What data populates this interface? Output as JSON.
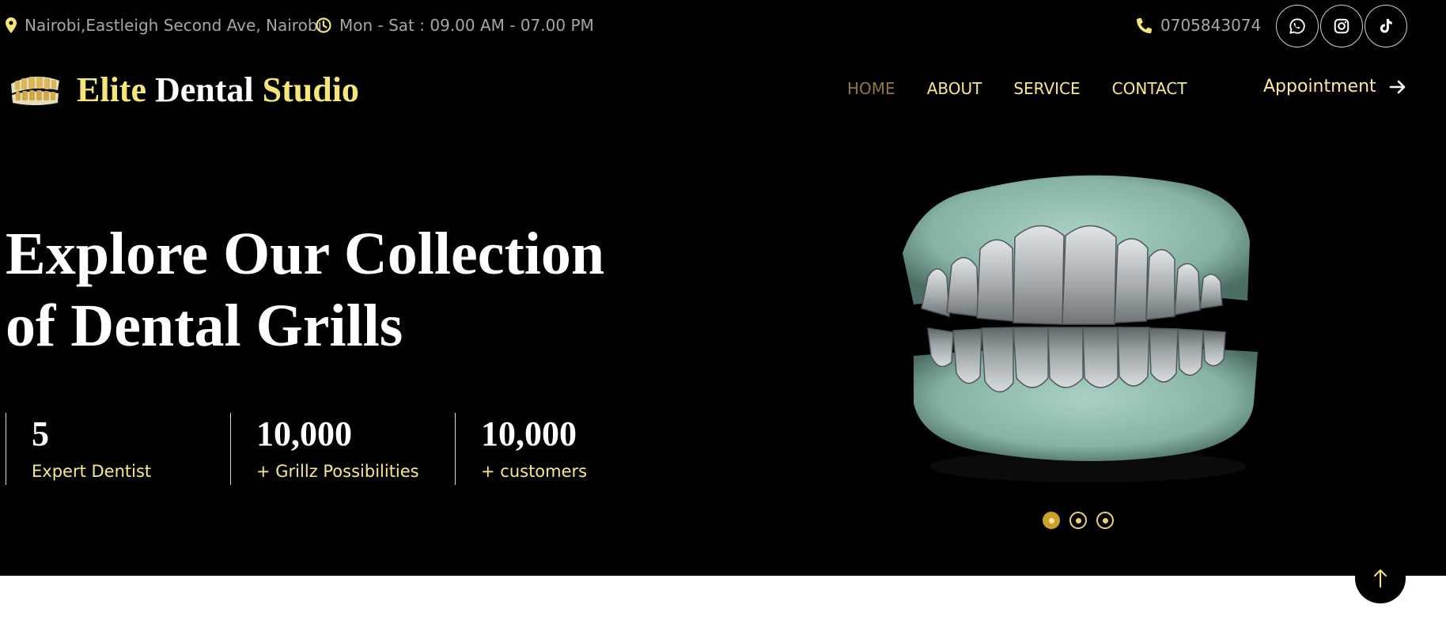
{
  "topbar": {
    "address": "Nairobi,Eastleigh Second Ave, Nairobi",
    "hours": "Mon - Sat : 09.00 AM - 07.00 PM",
    "phone": "0705843074",
    "socials": [
      {
        "icon": "whatsapp-icon"
      },
      {
        "icon": "instagram-icon"
      },
      {
        "icon": "tiktok-icon"
      }
    ]
  },
  "brand": {
    "word1": "Elite",
    "word2": "Dental",
    "word3": "Studio"
  },
  "nav": {
    "items": [
      "HOME",
      "ABOUT",
      "SERVICE",
      "CONTACT"
    ],
    "active": "HOME",
    "appointment_label": "Appointment"
  },
  "hero": {
    "title_line1": "Explore Our Collection",
    "title_line2": "of Dental Grills",
    "stats": [
      {
        "number": "5",
        "label": "Expert Dentist"
      },
      {
        "number": "10,000",
        "label": "+ Grillz Possibilities"
      },
      {
        "number": "10,000",
        "label": "+ customers"
      }
    ],
    "slides_total": 3,
    "active_slide": 1
  },
  "colors": {
    "background": "#000000",
    "accent_yellow": "#f4e67a",
    "nav_active": "#8c7a3e",
    "text_muted": "#a6a6a6"
  }
}
